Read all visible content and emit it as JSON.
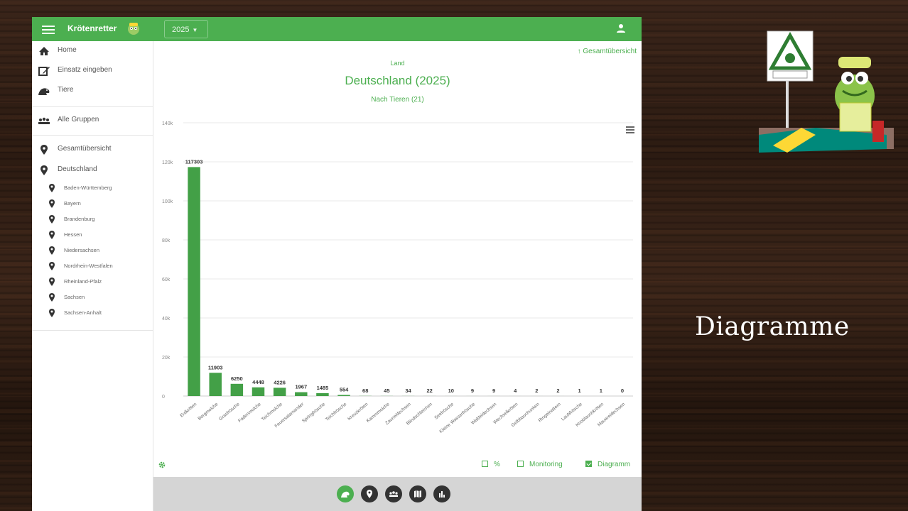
{
  "app": {
    "title": "Krötenretter",
    "year": "2025"
  },
  "sidebar": {
    "main": [
      {
        "label": "Home",
        "icon": "home-icon"
      },
      {
        "label": "Einsatz eingeben",
        "icon": "edit-icon"
      },
      {
        "label": "Tiere",
        "icon": "frog-icon"
      }
    ],
    "groups": {
      "label": "Alle Gruppen",
      "icon": "groups-icon"
    },
    "locations": [
      {
        "label": "Gesamtübersicht",
        "icon": "location-pin-icon"
      },
      {
        "label": "Deutschland",
        "icon": "location-pin-icon"
      }
    ],
    "states": [
      "Baden-Württemberg",
      "Bayern",
      "Brandenburg",
      "Hessen",
      "Niedersachsen",
      "Nordrhein-Westfalen",
      "Rheinland-Pfalz",
      "Sachsen",
      "Sachsen-Anhalt"
    ]
  },
  "content": {
    "overview_link": "↑ Gesamtübersicht",
    "level": "Land",
    "heading": "Deutschland (2025)",
    "subheading": "Nach Tieren (21)"
  },
  "options": {
    "percent": "%",
    "monitoring": "Monitoring",
    "diagram": "Diagramm",
    "percent_checked": false,
    "monitoring_checked": false,
    "diagram_checked": true
  },
  "slide": {
    "title": "Diagramme"
  },
  "colors": {
    "primary": "#4caf50",
    "bar": "#43a047"
  },
  "chart_data": {
    "type": "bar",
    "categories": [
      "Erdkröten",
      "Bergmolche",
      "Grasfrösche",
      "Fadenmolche",
      "Teichmolche",
      "Feuersalamander",
      "Springfrösche",
      "Teichfrösche",
      "Kreuzkröten",
      "Kammmolche",
      "Zauneidechsen",
      "Blindschleichen",
      "Seefrösche",
      "Kleine Wasserfrösche",
      "Waldeidechsen",
      "Wechselkröten",
      "Gelbbauchunken",
      "Ringelnattern",
      "Laubfrösche",
      "Knoblauchkröten",
      "Mauereidechsen"
    ],
    "values": [
      117303,
      11903,
      6250,
      4448,
      4226,
      1967,
      1485,
      554,
      68,
      45,
      34,
      22,
      10,
      9,
      9,
      4,
      2,
      2,
      1,
      1,
      0
    ],
    "ylim": [
      0,
      140000
    ],
    "yticks": [
      "0",
      "20k",
      "40k",
      "60k",
      "80k",
      "100k",
      "120k",
      "140k"
    ],
    "grid": true,
    "data_labels": true
  }
}
